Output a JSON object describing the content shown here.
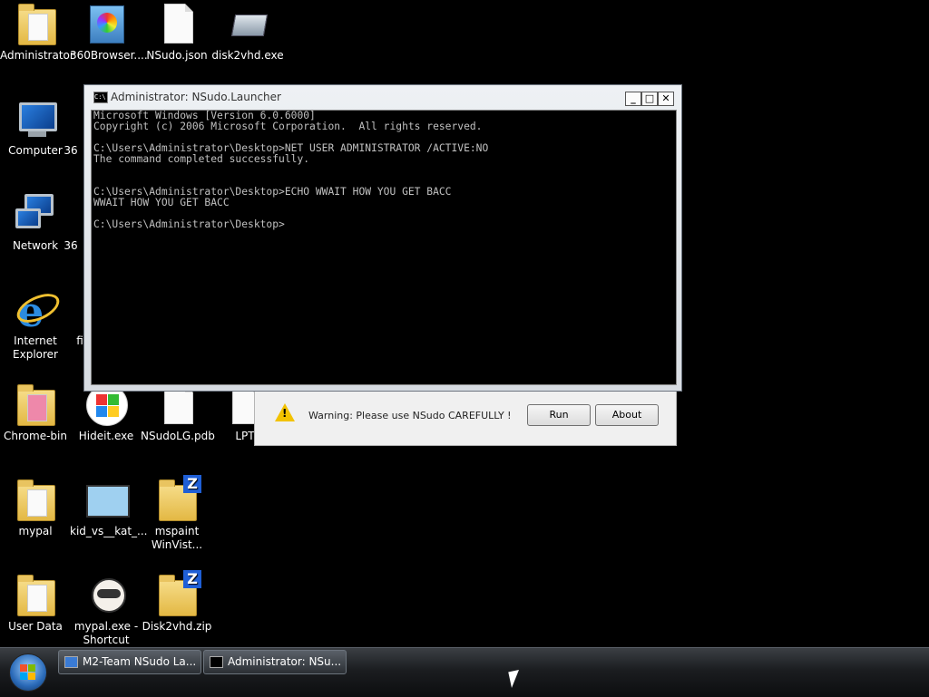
{
  "desktop": {
    "icons": [
      {
        "label": "Administrator",
        "label2": ""
      },
      {
        "label": "360Browser....",
        "label2": ""
      },
      {
        "label": "NSudo.json",
        "label2": ""
      },
      {
        "label": "disk2vhd.exe",
        "label2": ""
      },
      {
        "label": "Computer",
        "label2": ""
      },
      {
        "label": "36",
        "label2": ""
      },
      {
        "label": "Network",
        "label2": ""
      },
      {
        "label": "36",
        "label2": ""
      },
      {
        "label": "Internet",
        "label2": "Explorer"
      },
      {
        "label": "fi",
        "label2": ""
      },
      {
        "label": "Chrome-bin",
        "label2": ""
      },
      {
        "label": "Hideit.exe",
        "label2": ""
      },
      {
        "label": "NSudoLG.pdb",
        "label2": ""
      },
      {
        "label": "LPT",
        "label2": ""
      },
      {
        "label": "mypal",
        "label2": ""
      },
      {
        "label": "kid_vs__kat_...",
        "label2": ""
      },
      {
        "label": "mspaint",
        "label2": "WinVist..."
      },
      {
        "label": "User Data",
        "label2": ""
      },
      {
        "label": "mypal.exe -",
        "label2": "Shortcut"
      },
      {
        "label": "Disk2vhd.zip",
        "label2": ""
      }
    ]
  },
  "cmd_window": {
    "title": "Administrator: NSudo.Launcher",
    "minimize": "_",
    "maximize": "□",
    "close": "✕",
    "lines": [
      "Microsoft Windows [Version 6.0.6000]",
      "Copyright (c) 2006 Microsoft Corporation.  All rights reserved.",
      "",
      "C:\\Users\\Administrator\\Desktop>NET USER ADMINISTRATOR /ACTIVE:NO",
      "The command completed successfully.",
      "",
      "",
      "C:\\Users\\Administrator\\Desktop>ECHO WWAIT HOW YOU GET BACC",
      "WWAIT HOW YOU GET BACC",
      "",
      "C:\\Users\\Administrator\\Desktop>"
    ]
  },
  "nsudo_dialog": {
    "warning": "Warning: Please use NSudo CAREFULLY !",
    "run_label": "Run",
    "about_label": "About"
  },
  "taskbar": {
    "buttons": [
      {
        "label": "M2-Team NSudo La..."
      },
      {
        "label": "Administrator: NSu..."
      }
    ]
  },
  "colors": {
    "desktop_bg": "#000000",
    "console_text": "#c0c0c0",
    "warning_yellow": "#f2c200"
  }
}
